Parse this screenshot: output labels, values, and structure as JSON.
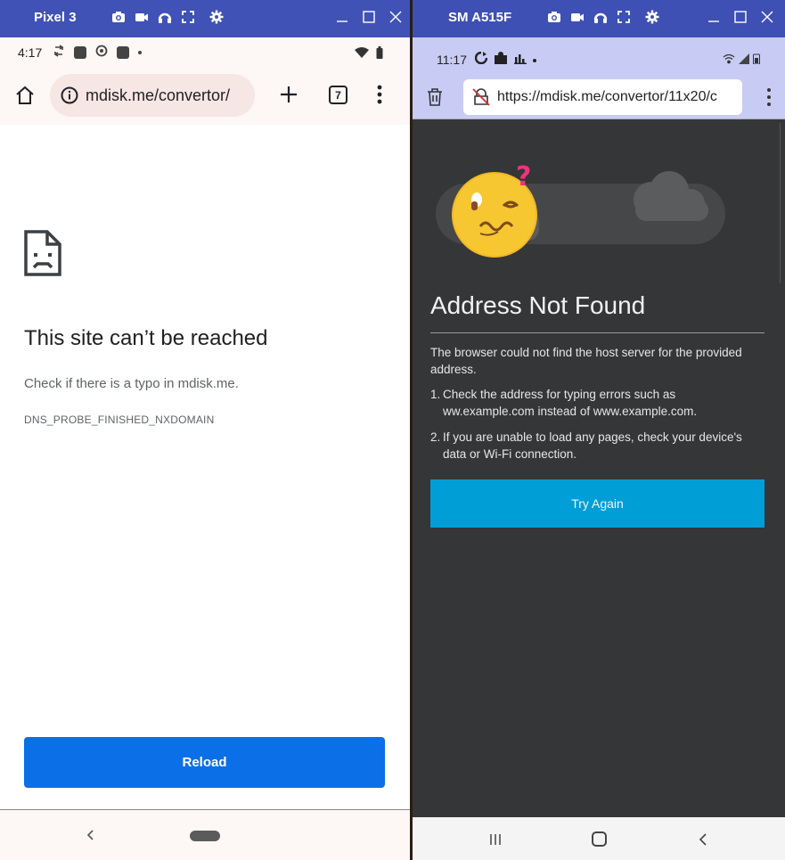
{
  "left_window": {
    "device_name": "Pixel 3",
    "status_bar": {
      "time": "4:17"
    },
    "toolbar": {
      "url": "mdisk.me/convertor/",
      "tab_count": "7"
    },
    "error": {
      "title": "This site can’t be reached",
      "message": "Check if there is a typo in mdisk.me.",
      "code": "DNS_PROBE_FINISHED_NXDOMAIN",
      "reload_label": "Reload"
    },
    "colors": {
      "title_bar": "#4052b5",
      "reload_button": "#0b6fe8",
      "chrome_bg": "#fdf7f6"
    }
  },
  "right_window": {
    "device_name": "SM A515F",
    "status_bar": {
      "time": "11:17"
    },
    "toolbar": {
      "url": "https://mdisk.me/convertor/11x20/c"
    },
    "error": {
      "title": "Address Not Found",
      "description": "The browser could not find the host server for the provided address.",
      "items": [
        {
          "num": "1.",
          "text": "Check the address for typing errors such as ww.example.com instead of www.example.com."
        },
        {
          "num": "2.",
          "text": "If you are unable to load any pages, check your device's data or Wi-Fi connection."
        }
      ],
      "try_again_label": "Try Again"
    },
    "colors": {
      "title_bar": "#3e50b4",
      "try_again_button": "#009ed7",
      "page_bg": "#343638",
      "chrome_bg": "#c8ccf4"
    }
  }
}
